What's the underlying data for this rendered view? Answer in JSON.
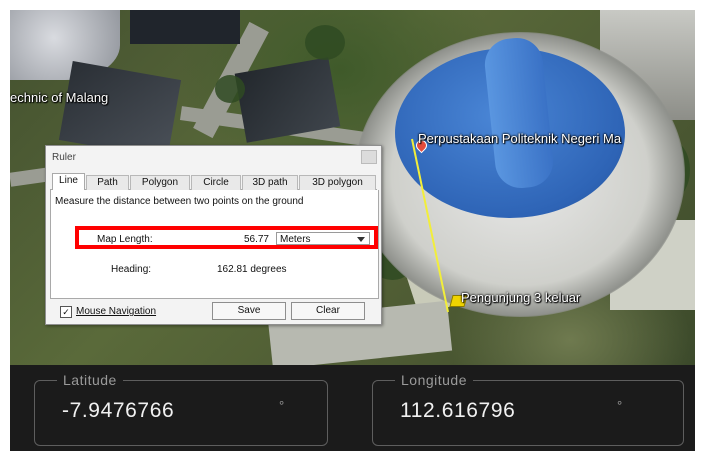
{
  "map": {
    "label_left": "echnic of Malang",
    "label_library": "Perpustakaan Politeknik Negeri Ma",
    "label_visitor": "Pengunjung 3 keluar"
  },
  "ruler": {
    "title": "Ruler",
    "tabs": [
      "Line",
      "Path",
      "Polygon",
      "Circle",
      "3D path",
      "3D polygon"
    ],
    "description": "Measure the distance between two points on the ground",
    "map_length_label": "Map Length:",
    "map_length_value": "56.77",
    "units": "Meters",
    "heading_label": "Heading:",
    "heading_value": "162.81 degrees",
    "mouse_navigation": "Mouse Navigation",
    "mouse_navigation_checked": true,
    "save": "Save",
    "clear": "Clear"
  },
  "coordinates": {
    "latitude_label": "Latitude",
    "latitude_value": "-7.9476766",
    "longitude_label": "Longitude",
    "longitude_value": "112.616796",
    "unit": "°"
  },
  "colors": {
    "highlight": "#ff0000",
    "measure_line": "#f2ee3a",
    "library_roof": "#2e64b6"
  }
}
